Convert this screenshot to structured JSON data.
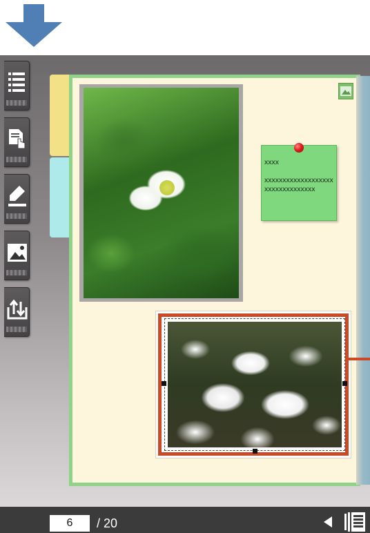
{
  "colors": {
    "arrow": "#4f7fb4",
    "page_border": "#8fd28a",
    "page_bg": "#fdf6dc",
    "tab_yellow": "#f2e186",
    "tab_cyan": "#aeeaea",
    "note_bg": "#7fd87e",
    "selection": "#c84a26",
    "bottom_bar": "#3c3b3c"
  },
  "toolbar": {
    "tools": [
      {
        "icon": "list-icon"
      },
      {
        "icon": "document-touch-icon"
      },
      {
        "icon": "highlighter-icon"
      },
      {
        "icon": "image-icon"
      },
      {
        "icon": "export-icon"
      }
    ]
  },
  "note": {
    "line1": "xxxx",
    "body": "xxxxxxxxxxxxxxxxxxxxxxxxxxxxxxxxx"
  },
  "pager": {
    "current_page": "6",
    "total": "/ 20"
  }
}
